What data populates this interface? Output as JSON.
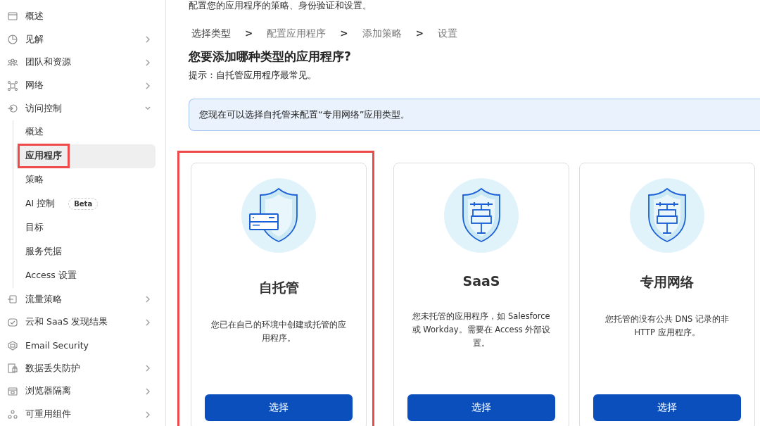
{
  "sidebar": {
    "items": [
      {
        "label": "概述"
      },
      {
        "label": "见解",
        "expanded": false
      },
      {
        "label": "团队和资源",
        "expanded": false
      },
      {
        "label": "网络",
        "expanded": false
      },
      {
        "label": "访问控制",
        "expanded": true,
        "children": [
          {
            "label": "概述",
            "selected": false,
            "highlighted": false
          },
          {
            "label": "应用程序",
            "selected": true,
            "highlighted": true
          },
          {
            "label": "策略",
            "selected": false,
            "highlighted": false
          },
          {
            "label": "AI 控制",
            "badge": "Beta",
            "selected": false,
            "highlighted": false
          },
          {
            "label": "目标",
            "selected": false,
            "highlighted": false
          },
          {
            "label": "服务凭据",
            "selected": false,
            "highlighted": false
          },
          {
            "label": "Access 设置",
            "selected": false,
            "highlighted": false
          }
        ]
      },
      {
        "label": "流量策略",
        "expanded": false
      },
      {
        "label": "云和 SaaS 发现结果",
        "expanded": false
      },
      {
        "label": "Email Security"
      },
      {
        "label": "数据丢失防护",
        "expanded": false
      },
      {
        "label": "浏览器隔离",
        "expanded": false
      },
      {
        "label": "可重用组件",
        "expanded": false
      }
    ]
  },
  "main": {
    "intro": "配置您的应用程序的策略、身份验证和设置。",
    "steps": [
      {
        "label": "选择类型",
        "selected": true
      },
      {
        "label": "配置应用程序",
        "selected": false
      },
      {
        "label": "添加策略",
        "selected": false
      },
      {
        "label": "设置",
        "selected": false
      }
    ],
    "step_separator": ">",
    "heading": "您要添加哪种类型的应用程序?",
    "hint": "提示：自托管应用程序最常见。",
    "notice": "您现在可以选择自托管来配置“专用网络”应用类型。",
    "cards": [
      {
        "kind": "server",
        "title": "自托管",
        "description": "您已在自己的环境中创建或托管的应用程序。",
        "button": "选择",
        "highlighted": true
      },
      {
        "kind": "network",
        "title": "SaaS",
        "description": "您未托管的应用程序，如 Salesforce 或 Workday。需要在 Access 外部设置。",
        "button": "选择",
        "highlighted": false
      },
      {
        "kind": "network",
        "title": "专用网络",
        "description": "您托管的没有公共 DNS 记录的非 HTTP 应用程序。",
        "button": "选择",
        "highlighted": false
      }
    ]
  }
}
